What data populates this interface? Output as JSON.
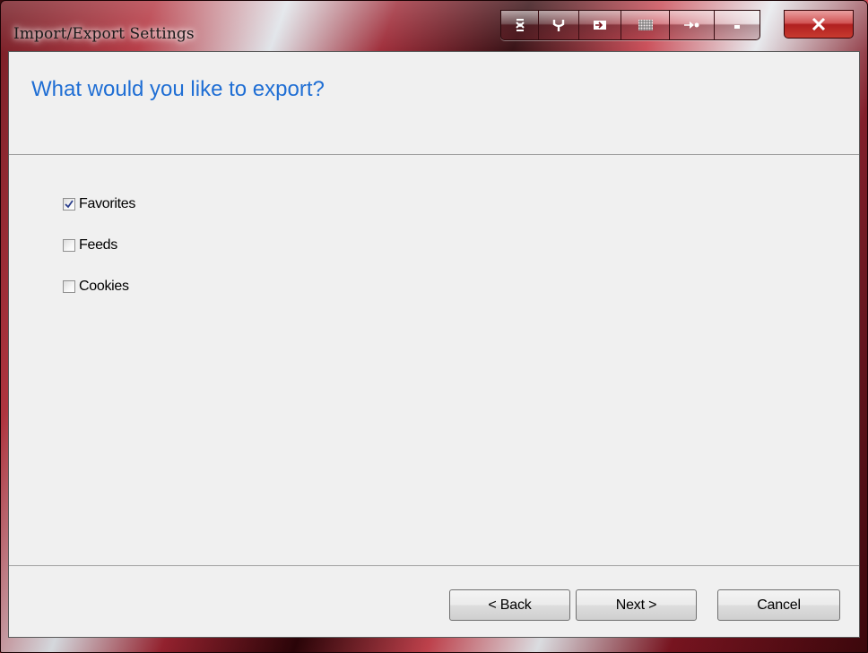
{
  "window": {
    "title": "Import/Export Settings",
    "caption_buttons": [
      {
        "name": "scroll-icon",
        "glyph": "↕"
      },
      {
        "name": "wrench-icon",
        "glyph": "Ψ"
      },
      {
        "name": "enter-icon",
        "glyph": "⇥"
      },
      {
        "name": "texture-icon",
        "glyph": "▒"
      },
      {
        "name": "pin-icon",
        "glyph": "▸"
      },
      {
        "name": "minimize-icon",
        "glyph": "▬"
      }
    ],
    "close_glyph": "X"
  },
  "header": {
    "question": "What would you like to export?"
  },
  "options": [
    {
      "label": "Favorites",
      "checked": true
    },
    {
      "label": "Feeds",
      "checked": false
    },
    {
      "label": "Cookies",
      "checked": false
    }
  ],
  "buttons": {
    "back": "< Back",
    "next": "Next >",
    "cancel": "Cancel"
  },
  "colors": {
    "heading": "#1f6ed4",
    "dialog_bg": "#f0f0f0",
    "frame_accent": "#b3323d"
  }
}
